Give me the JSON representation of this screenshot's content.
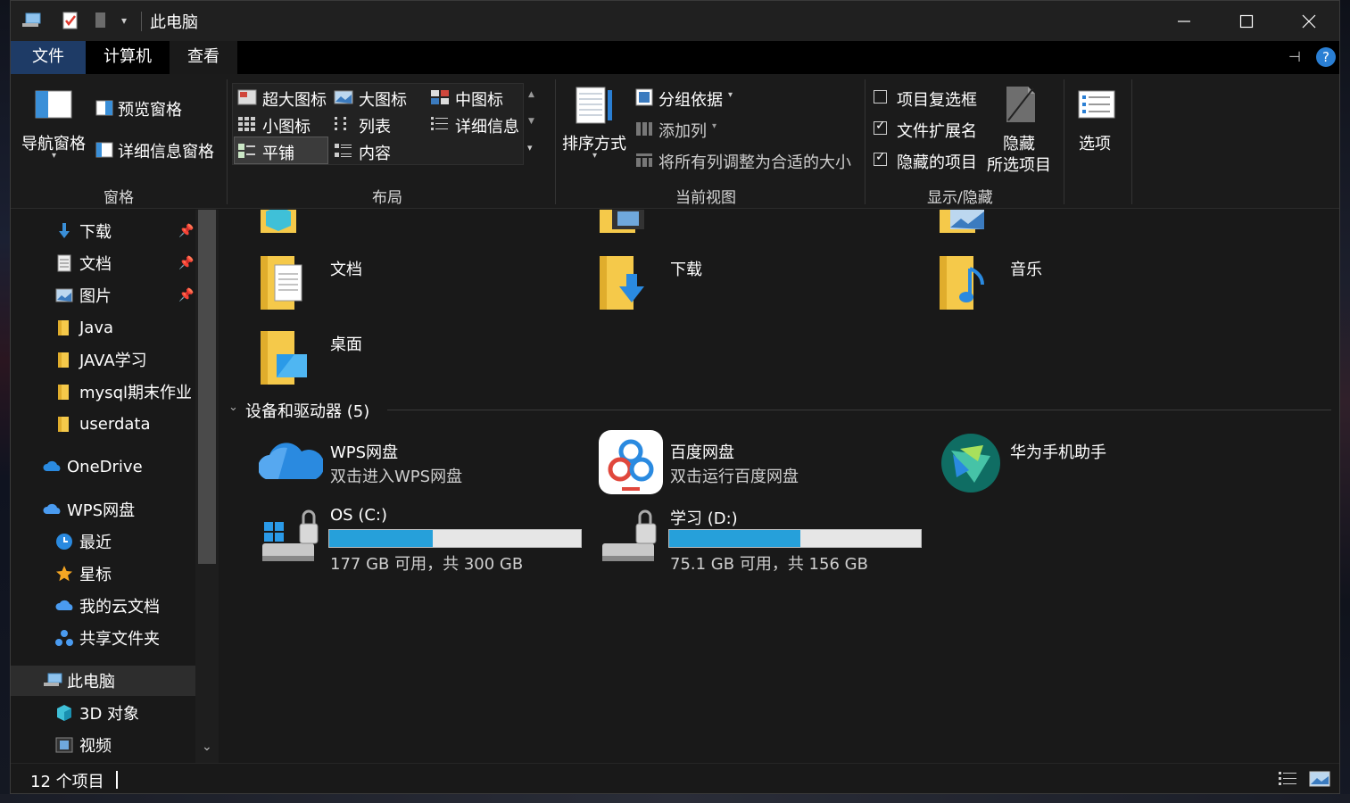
{
  "window": {
    "title": "此电脑",
    "controls": {
      "minimize": "—",
      "maximize": "☐",
      "close": "✕"
    }
  },
  "tabs": [
    {
      "label": "文件"
    },
    {
      "label": "计算机"
    },
    {
      "label": "查看"
    }
  ],
  "ribbon": {
    "groups": {
      "panes": "窗格",
      "layout": "布局",
      "current_view": "当前视图",
      "show_hide": "显示/隐藏"
    },
    "panes": {
      "nav_pane": "导航窗格",
      "preview_pane": "预览窗格",
      "details_pane": "详细信息窗格"
    },
    "layout": {
      "extra_large": "超大图标",
      "large": "大图标",
      "medium": "中图标",
      "small": "小图标",
      "list": "列表",
      "details": "详细信息",
      "tiles": "平铺",
      "content": "内容",
      "selected": "平铺"
    },
    "current_view": {
      "sort_by": "排序方式",
      "group_by": "分组依据",
      "add_columns": "添加列",
      "size_all_columns": "将所有列调整为合适的大小"
    },
    "show_hide": {
      "item_checkboxes": {
        "label": "项目复选框",
        "checked": false
      },
      "file_extensions": {
        "label": "文件扩展名",
        "checked": true
      },
      "hidden_items": {
        "label": "隐藏的项目",
        "checked": true
      },
      "hide_selected_line1": "隐藏",
      "hide_selected_line2": "所选项目"
    },
    "options": "选项"
  },
  "nav": {
    "items": [
      {
        "label": "下载",
        "pinned": true
      },
      {
        "label": "文档",
        "pinned": true
      },
      {
        "label": "图片",
        "pinned": true
      },
      {
        "label": "Java"
      },
      {
        "label": "JAVA学习"
      },
      {
        "label": "mysql期末作业"
      },
      {
        "label": "userdata"
      },
      {
        "label": "OneDrive"
      },
      {
        "label": "WPS网盘"
      },
      {
        "label": "最近"
      },
      {
        "label": "星标"
      },
      {
        "label": "我的云文档"
      },
      {
        "label": "共享文件夹"
      },
      {
        "label": "此电脑"
      },
      {
        "label": "3D 对象"
      },
      {
        "label": "视频"
      }
    ],
    "selected": "此电脑"
  },
  "content": {
    "folders": [
      {
        "name": "文档"
      },
      {
        "name": "下载"
      },
      {
        "name": "音乐"
      },
      {
        "name": "桌面"
      }
    ],
    "devices_header": "设备和驱动器 (5)",
    "devices": [
      {
        "name": "WPS网盘",
        "sub": "双击进入WPS网盘"
      },
      {
        "name": "百度网盘",
        "sub": "双击运行百度网盘"
      },
      {
        "name": "华为手机助手",
        "sub": ""
      }
    ],
    "drives": [
      {
        "name": "OS (C:)",
        "info": "177 GB 可用，共 300 GB",
        "used_fraction": 0.41
      },
      {
        "name": "学习 (D:)",
        "info": "75.1 GB 可用，共 156 GB",
        "used_fraction": 0.52
      }
    ]
  },
  "status": {
    "count": "12 个项目"
  },
  "colors": {
    "accent": "#26a0da",
    "file_tab": "#1e3b66",
    "folder": "#f5c94a"
  }
}
